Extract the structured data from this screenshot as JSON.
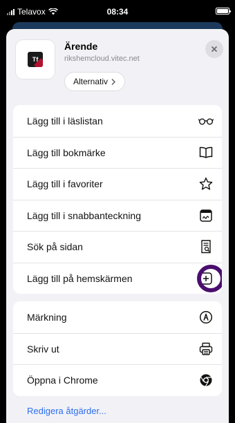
{
  "status_bar": {
    "carrier": "Telavox",
    "time": "08:34"
  },
  "header": {
    "title": "Ärende",
    "url": "rikshemcloud.vitec.net",
    "options_label": "Alternativ",
    "app_icon_text": "Tf"
  },
  "actions_primary": [
    {
      "label": "Lägg till i läslistan",
      "icon": "glasses-icon"
    },
    {
      "label": "Lägg till bokmärke",
      "icon": "book-icon"
    },
    {
      "label": "Lägg till i favoriter",
      "icon": "star-icon"
    },
    {
      "label": "Lägg till i snabbanteckning",
      "icon": "quick-note-icon"
    },
    {
      "label": "Sök på sidan",
      "icon": "find-on-page-icon"
    },
    {
      "label": "Lägg till på hemskärmen",
      "icon": "add-square-icon",
      "highlighted": true
    }
  ],
  "actions_secondary": [
    {
      "label": "Märkning",
      "icon": "markup-icon"
    },
    {
      "label": "Skriv ut",
      "icon": "printer-icon"
    },
    {
      "label": "Öppna i Chrome",
      "icon": "chrome-icon"
    }
  ],
  "edit_actions_label": "Redigera åtgärder...",
  "colors": {
    "sheet_background": "#f2f2f6",
    "highlight_ring": "#4a0e6e",
    "link": "#2b6ef0"
  }
}
